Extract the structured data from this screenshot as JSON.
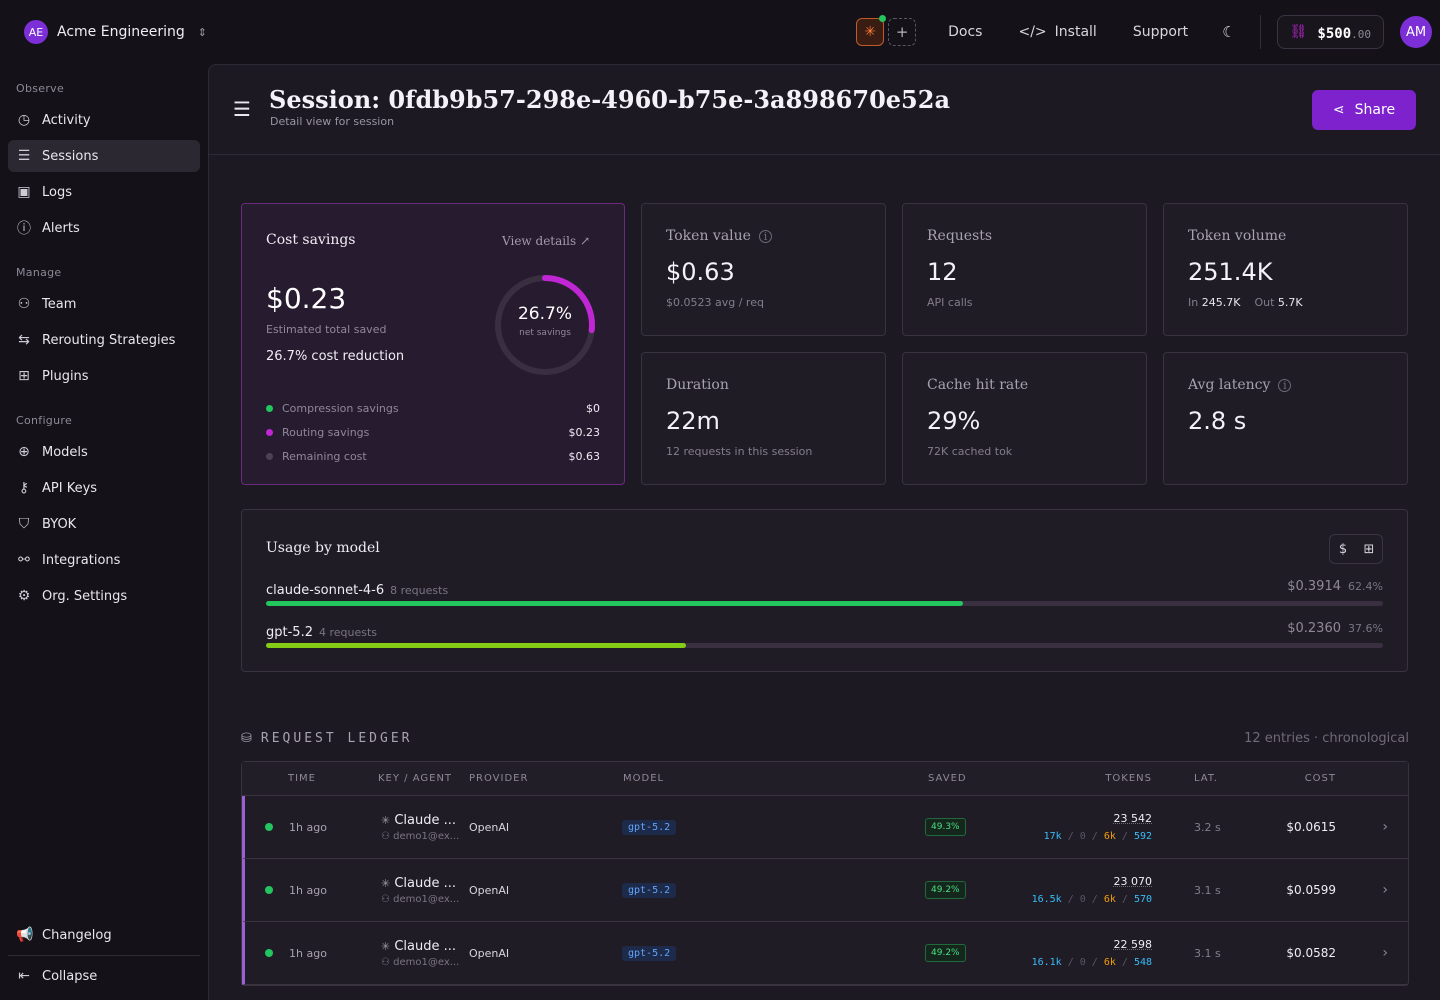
{
  "org": {
    "initials": "AE",
    "name": "Acme Engineering"
  },
  "topbar": {
    "docs": "Docs",
    "install": "Install",
    "support": "Support",
    "credit_main": "$500",
    "credit_cents": ".00",
    "user_initials": "AM"
  },
  "sidebar": {
    "sections": [
      {
        "label": "Observe",
        "items": [
          {
            "label": "Activity",
            "icon": "clock-icon"
          },
          {
            "label": "Sessions",
            "icon": "list-icon",
            "active": true
          },
          {
            "label": "Logs",
            "icon": "chart-icon"
          },
          {
            "label": "Alerts",
            "icon": "alert-icon"
          }
        ]
      },
      {
        "label": "Manage",
        "items": [
          {
            "label": "Team",
            "icon": "users-icon"
          },
          {
            "label": "Rerouting Strategies",
            "icon": "route-icon"
          },
          {
            "label": "Plugins",
            "icon": "plugin-icon"
          }
        ]
      },
      {
        "label": "Configure",
        "items": [
          {
            "label": "Models",
            "icon": "brain-icon"
          },
          {
            "label": "API Keys",
            "icon": "key-icon"
          },
          {
            "label": "BYOK",
            "icon": "shield-icon"
          },
          {
            "label": "Integrations",
            "icon": "integrations-icon"
          },
          {
            "label": "Org. Settings",
            "icon": "gear-icon"
          }
        ]
      }
    ],
    "changelog": "Changelog",
    "collapse": "Collapse"
  },
  "page": {
    "title": "Session: 0fdb9b57-298e-4960-b75e-3a898670e52a",
    "subtitle": "Detail view for session",
    "share": "Share"
  },
  "savings": {
    "title": "Cost savings",
    "link": "View details",
    "amount": "$0.23",
    "estimated": "Estimated total saved",
    "reduction": "26.7% cost reduction",
    "donut_pct": "26.7%",
    "donut_fraction": 0.267,
    "donut_label": "net savings",
    "rows": [
      {
        "label": "Compression savings",
        "value": "$0",
        "color": "#22c55e"
      },
      {
        "label": "Routing savings",
        "value": "$0.23",
        "color": "#c026d3"
      },
      {
        "label": "Remaining cost",
        "value": "$0.63",
        "color": "#4a4452"
      }
    ]
  },
  "stats": {
    "token_value": {
      "label": "Token value",
      "value": "$0.63",
      "sub": "$0.0523 avg / req"
    },
    "requests": {
      "label": "Requests",
      "value": "12",
      "sub": "API calls"
    },
    "token_volume": {
      "label": "Token volume",
      "value": "251.4K",
      "in_label": "In",
      "in_value": "245.7K",
      "out_label": "Out",
      "out_value": "5.7K"
    },
    "duration": {
      "label": "Duration",
      "value": "22m",
      "sub": "12 requests in this session"
    },
    "cache": {
      "label": "Cache hit rate",
      "value": "29%",
      "sub": "72K cached tok"
    },
    "latency": {
      "label": "Avg latency",
      "value": "2.8 s"
    }
  },
  "usage": {
    "title": "Usage by model",
    "models": [
      {
        "name": "claude-sonnet-4-6",
        "requests": "8 requests",
        "cost": "$0.3914",
        "pct": "62.4%",
        "fraction": 0.624,
        "color": "#22c55e"
      },
      {
        "name": "gpt-5.2",
        "requests": "4 requests",
        "cost": "$0.2360",
        "pct": "37.6%",
        "fraction": 0.376,
        "color": "#84cc16"
      }
    ]
  },
  "ledger": {
    "title": "REQUEST LEDGER",
    "meta": "12 entries · chronological",
    "columns": {
      "time": "TIME",
      "key": "KEY / AGENT",
      "provider": "PROVIDER",
      "model": "MODEL",
      "saved": "SAVED",
      "tokens": "TOKENS",
      "lat": "LAT.",
      "cost": "COST"
    },
    "rows": [
      {
        "time": "1h ago",
        "agent": "Claude ...",
        "user": "demo1@ex...",
        "provider": "OpenAI",
        "model": "gpt-5.2",
        "saved": "49.3%",
        "tokens": "23 542",
        "t_in": "17k",
        "t_cache": "0",
        "t_mid": "6k",
        "t_out": "592",
        "lat": "3.2 s",
        "cost": "$0.0615"
      },
      {
        "time": "1h ago",
        "agent": "Claude ...",
        "user": "demo1@ex...",
        "provider": "OpenAI",
        "model": "gpt-5.2",
        "saved": "49.2%",
        "tokens": "23 070",
        "t_in": "16.5k",
        "t_cache": "0",
        "t_mid": "6k",
        "t_out": "570",
        "lat": "3.1 s",
        "cost": "$0.0599"
      },
      {
        "time": "1h ago",
        "agent": "Claude ...",
        "user": "demo1@ex...",
        "provider": "OpenAI",
        "model": "gpt-5.2",
        "saved": "49.2%",
        "tokens": "22 598",
        "t_in": "16.1k",
        "t_cache": "0",
        "t_mid": "6k",
        "t_out": "548",
        "lat": "3.1 s",
        "cost": "$0.0582"
      }
    ]
  }
}
